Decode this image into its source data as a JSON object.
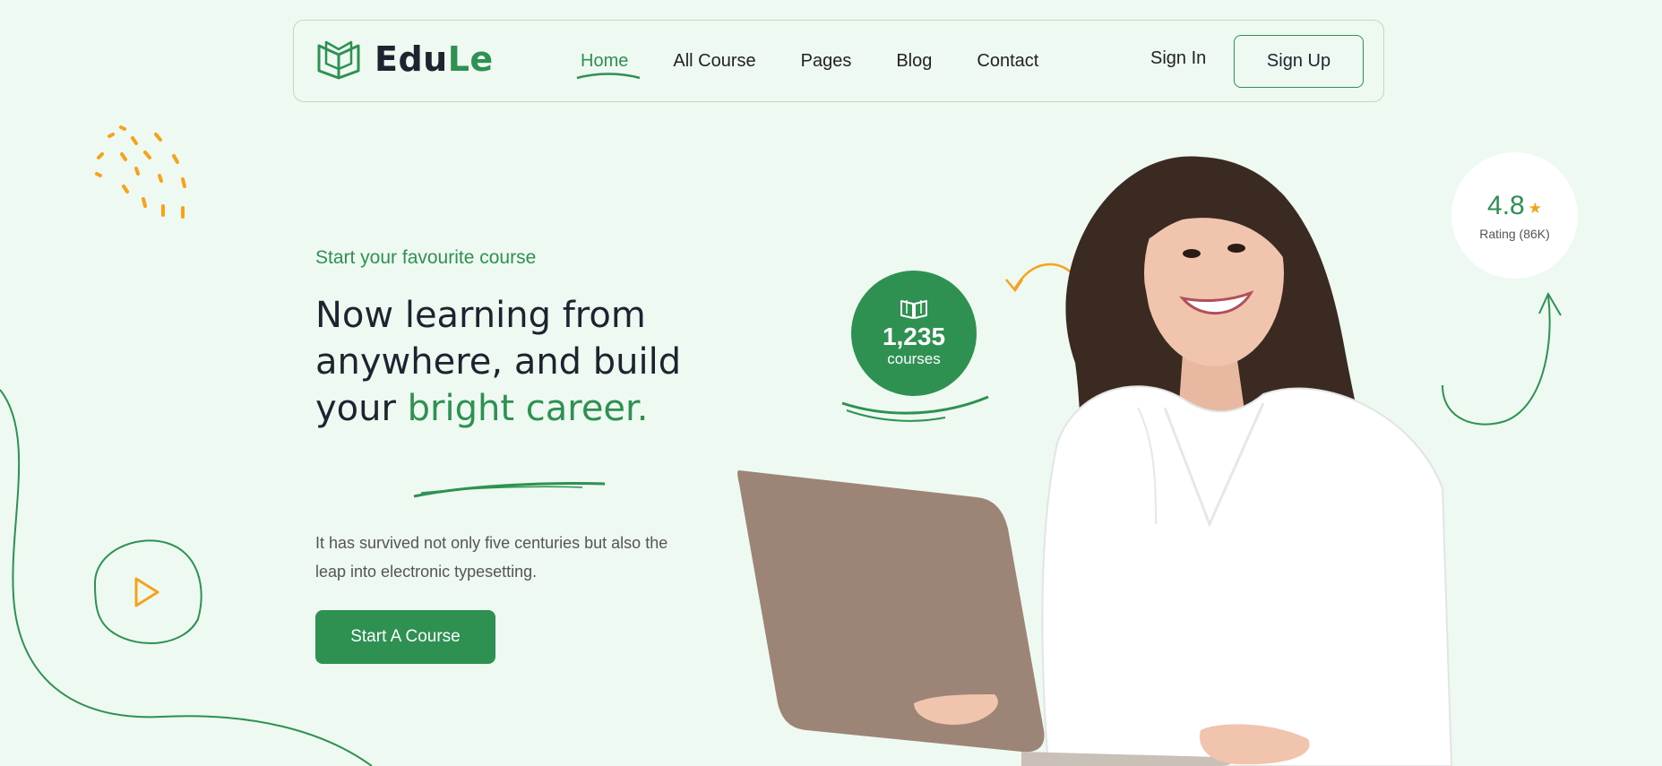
{
  "brand": {
    "name_part1": "Edu",
    "name_part2": "Le",
    "accent_color": "#2e9152",
    "logo_icon": "open-book-icon"
  },
  "nav": {
    "items": [
      {
        "label": "Home",
        "active": true
      },
      {
        "label": "All Course",
        "active": false
      },
      {
        "label": "Pages",
        "active": false
      },
      {
        "label": "Blog",
        "active": false
      },
      {
        "label": "Contact",
        "active": false
      }
    ],
    "signin_label": "Sign In",
    "signup_label": "Sign Up"
  },
  "hero": {
    "eyebrow": "Start your favourite course",
    "headline_part1": "Now learning from anywhere, and build your ",
    "headline_highlight": "bright career.",
    "paragraph": "It has survived not only five centuries but also the leap into electronic typesetting.",
    "cta_label": "Start A Course"
  },
  "stats": {
    "courses_count": "1,235",
    "courses_label": "courses",
    "courses_icon": "book-icon",
    "rating_value": "4.8",
    "rating_icon": "star-icon",
    "rating_label": "Rating (86K)"
  },
  "colors": {
    "background": "#edf9f1",
    "primary": "#2e9152",
    "accent_orange": "#f6a21b",
    "text_dark": "#1d2430"
  }
}
